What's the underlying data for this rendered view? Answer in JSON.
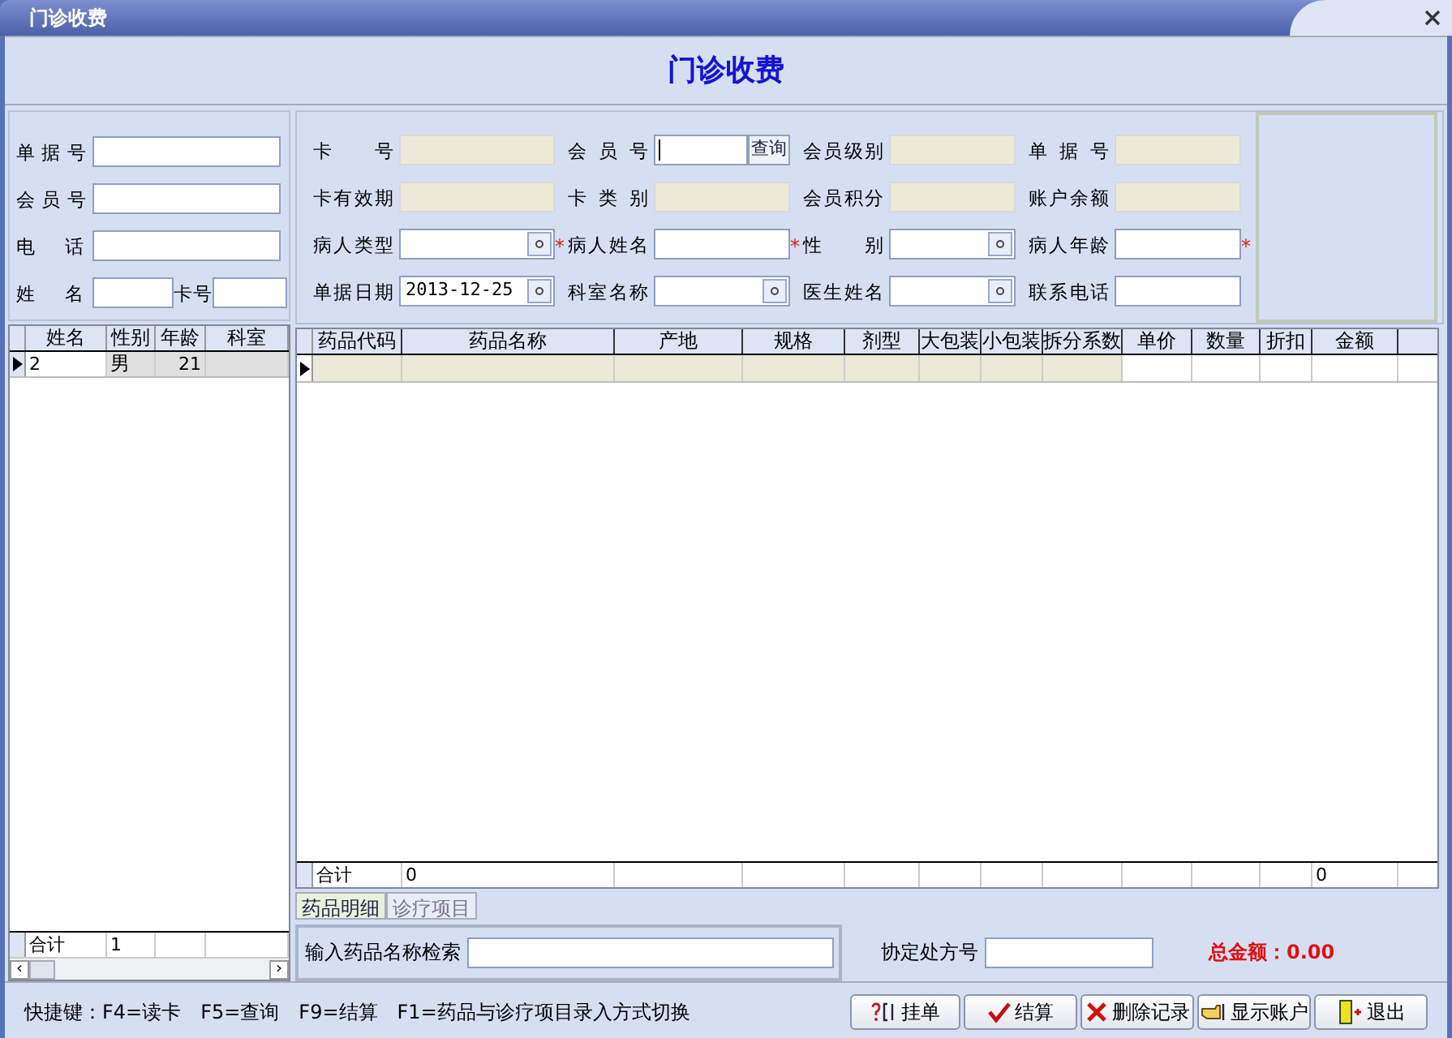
{
  "window": {
    "title": "门诊收费"
  },
  "header": "门诊收费",
  "left_form": [
    {
      "label": "单 据 号"
    },
    {
      "label": "会 员 号"
    },
    {
      "label": "电 话"
    }
  ],
  "left_name": {
    "label": "姓 名",
    "card_label": "卡号"
  },
  "fields": [
    {
      "label": "卡 号",
      "kind": "readonly",
      "required": false
    },
    {
      "label": "会 员 号",
      "kind": "query",
      "required": false,
      "button": "查询"
    },
    {
      "label": "会员级别",
      "kind": "readonly",
      "required": false
    },
    {
      "label": "单 据 号",
      "kind": "readonly",
      "required": false
    },
    {
      "label": "卡有效期",
      "kind": "readonly",
      "required": false
    },
    {
      "label": "卡 类 别",
      "kind": "readonly",
      "required": false
    },
    {
      "label": "会员积分",
      "kind": "readonly",
      "required": false
    },
    {
      "label": "账户余额",
      "kind": "readonly",
      "required": false
    },
    {
      "label": "病人类型",
      "kind": "select",
      "required": false
    },
    {
      "label": "病人姓名",
      "kind": "text",
      "required": true
    },
    {
      "label": "性 别",
      "kind": "select",
      "required": true
    },
    {
      "label": "病人年龄",
      "kind": "text",
      "required": true,
      "required_after": true
    },
    {
      "label": "单据日期",
      "kind": "date",
      "required": false,
      "value": "2013-12-25"
    },
    {
      "label": "科室名称",
      "kind": "select",
      "required": false
    },
    {
      "label": "医生姓名",
      "kind": "select",
      "required": false
    },
    {
      "label": "联系电话",
      "kind": "text",
      "required": false
    }
  ],
  "patients": {
    "columns": [
      "姓名",
      "性别",
      "年龄",
      "科室"
    ],
    "rows": [
      {
        "cells": [
          "2",
          "男",
          "21"
        ],
        "selected": true
      }
    ],
    "total": {
      "label": "合计",
      "count": "1"
    }
  },
  "drugs": {
    "columns": [
      "药品代码",
      "药品名称",
      "产地",
      "规格",
      "剂型",
      "大包装",
      "小包装",
      "拆分系数",
      "单价",
      "数量",
      "折扣",
      "金额"
    ],
    "total": {
      "label": "合计",
      "count": "0",
      "amount": "0"
    }
  },
  "required_mark": "*",
  "scroll_arrows": [
    "‹",
    "›"
  ],
  "tabs": [
    {
      "label": "药品明细",
      "selected": true
    },
    {
      "label": "诊疗项目",
      "selected": false
    }
  ],
  "search_label": "输入药品名称检索",
  "prescription_label": "协定处方号",
  "grand_total": "总金额：0.00",
  "status_bar": "快捷键：F4=读卡　F5=查询　F9=结算　F1=药品与诊疗项目录入方式切换",
  "buttons": [
    {
      "label": "挂单",
      "kind": "hold"
    },
    {
      "label": "结算",
      "kind": "settle"
    },
    {
      "label": "删除记录",
      "kind": "delete"
    },
    {
      "label": "显示账户",
      "kind": "account"
    },
    {
      "label": "退出",
      "kind": "exit"
    }
  ]
}
